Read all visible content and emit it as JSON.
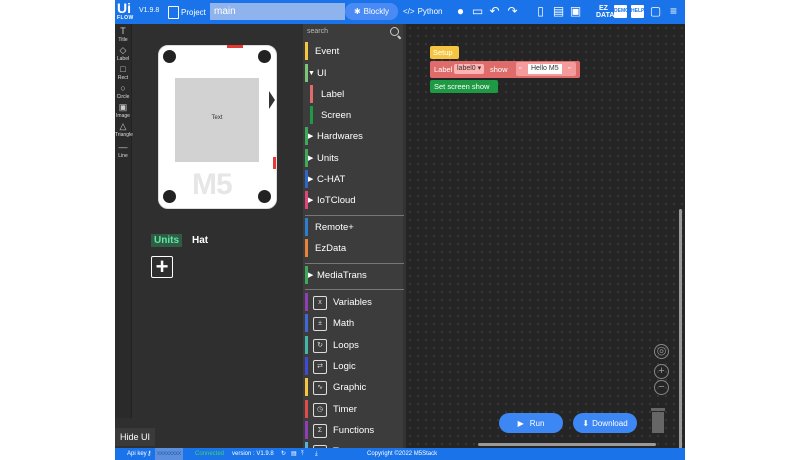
{
  "topbar": {
    "logo_main": "Ui",
    "logo_sub": "FLOW",
    "version": "V1.9.8",
    "project_label": "Project",
    "filename": "main",
    "blockly_tab": "Blockly",
    "python_tab": "Python",
    "ez_label": "EZ\nDATA",
    "demo_label": "DEMO",
    "help_label": "HELP"
  },
  "tools": [
    {
      "label": "Title",
      "icon": "T"
    },
    {
      "label": "Label",
      "icon": "◇"
    },
    {
      "label": "Rect",
      "icon": "□"
    },
    {
      "label": "Circle",
      "icon": "○"
    },
    {
      "label": "Image",
      "icon": "▣"
    },
    {
      "label": "Triangle",
      "icon": "△"
    },
    {
      "label": "Line",
      "icon": "—"
    }
  ],
  "preview": {
    "screen_text": "Text",
    "brand": "M5",
    "tabs": {
      "units": "Units",
      "hat": "Hat"
    },
    "add_symbol": "+",
    "hide_ui": "Hide UI"
  },
  "categories": {
    "search_placeholder": "search",
    "items": [
      {
        "label": "Event",
        "color": "#f5c542"
      },
      {
        "label": "UI",
        "color": "#7cc47a",
        "expanded": true
      },
      {
        "label": "Label",
        "color": "#e06b6b"
      },
      {
        "label": "Screen",
        "color": "#1e9944"
      },
      {
        "label": "Hardwares",
        "color": "#3fa95a"
      },
      {
        "label": "Units",
        "color": "#3fa95a"
      },
      {
        "label": "C-HAT",
        "color": "#2c67c9"
      },
      {
        "label": "IoTCloud",
        "color": "#e0457b"
      },
      {
        "label": "Remote+",
        "color": "#2c7fd0"
      },
      {
        "label": "EzData",
        "color": "#e8843a"
      },
      {
        "label": "MediaTrans",
        "color": "#3fa95a"
      },
      {
        "label": "Variables",
        "color": "#8e3fb5"
      },
      {
        "label": "Math",
        "color": "#3f69d6"
      },
      {
        "label": "Loops",
        "color": "#42b6a8"
      },
      {
        "label": "Logic",
        "color": "#3f4bd6"
      },
      {
        "label": "Graphic",
        "color": "#f5c542"
      },
      {
        "label": "Timer",
        "color": "#e24b4b"
      },
      {
        "label": "Functions",
        "color": "#8e3fb5"
      },
      {
        "label": "Text",
        "color": "#5ab0d6"
      }
    ]
  },
  "workspace": {
    "setup_block": "Setup",
    "label_block": {
      "prefix": "Label",
      "dropdown": "label0 ▾",
      "show": "show",
      "quote_open": "“",
      "text": "Hello M5",
      "quote_close": "”"
    },
    "screen_block": "Set screen show",
    "run_label": "Run",
    "download_label": "Download"
  },
  "statusbar": {
    "api_label": "Api key",
    "api_value": "xxxxxxxx",
    "connected": "Connected",
    "version": "version : V1.9.8",
    "copyright": "Copyright ©2022 M5Stack"
  }
}
